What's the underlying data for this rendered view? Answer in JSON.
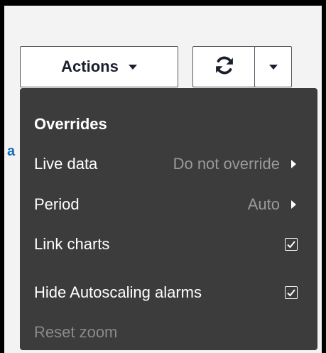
{
  "toolbar": {
    "actions_label": "Actions"
  },
  "menu": {
    "header": "Overrides",
    "live_data": {
      "label": "Live data",
      "value": "Do not override"
    },
    "period": {
      "label": "Period",
      "value": "Auto"
    },
    "link_charts": {
      "label": "Link charts",
      "checked": true
    },
    "hide_autoscaling": {
      "label": "Hide Autoscaling alarms",
      "checked": true
    },
    "reset_zoom": {
      "label": "Reset zoom",
      "disabled": true
    }
  },
  "background": {
    "edge_text": "a"
  },
  "colors": {
    "menu_bg": "#3c3c3c",
    "menu_text": "#ffffff",
    "menu_muted": "#9a9a9a",
    "link_blue": "#1a6fb5"
  },
  "icons": {
    "refresh": "refresh-icon",
    "dropdown": "caret-down-icon",
    "submenu": "caret-right-icon",
    "check": "checkmark-icon"
  }
}
